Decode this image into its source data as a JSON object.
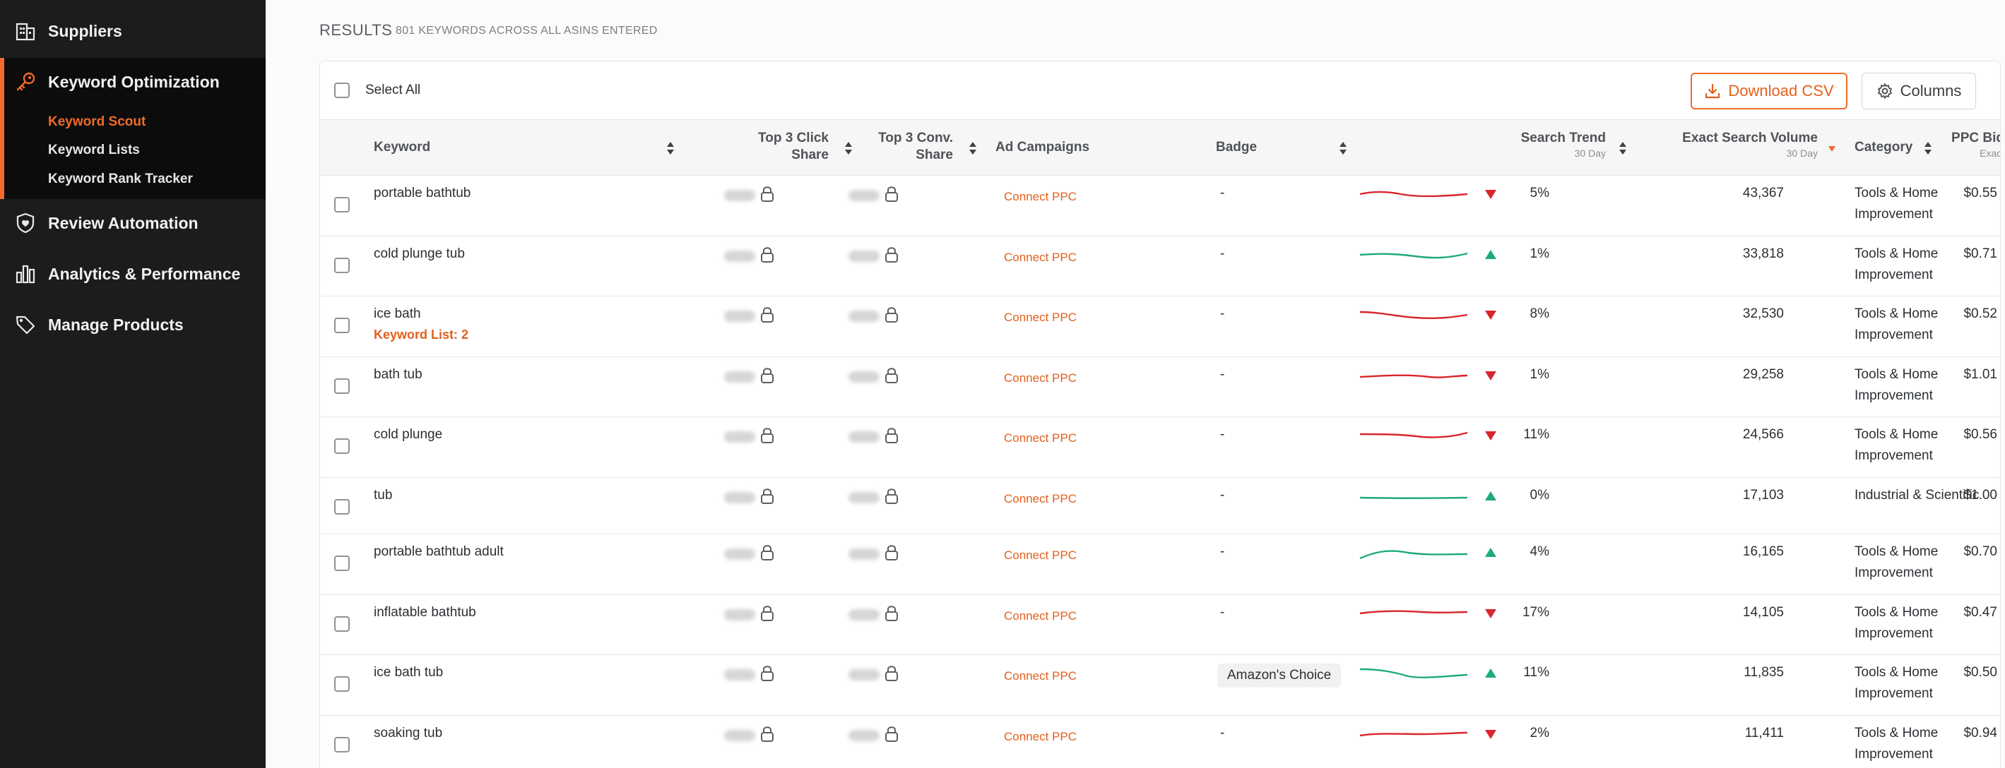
{
  "sidebar": {
    "items": [
      {
        "label": "Suppliers",
        "icon": "building-icon"
      },
      {
        "label": "Keyword Optimization",
        "icon": "key-icon",
        "active": true
      },
      {
        "label": "Review Automation",
        "icon": "review-shield-icon"
      },
      {
        "label": "Analytics & Performance",
        "icon": "bar-chart-icon"
      },
      {
        "label": "Manage Products",
        "icon": "tag-icon"
      }
    ],
    "subitems": [
      "Keyword Scout",
      "Keyword Lists",
      "Keyword Rank Tracker"
    ],
    "accent": "#f26b2a"
  },
  "results": {
    "heading": "RESULTS",
    "subheading": "801 KEYWORDS ACROSS ALL ASINS ENTERED"
  },
  "toolbar": {
    "select_all": "Select All",
    "download_csv": "Download CSV",
    "columns": "Columns"
  },
  "columns": {
    "keyword": "Keyword",
    "click_share_1": "Top 3 Click",
    "click_share_2": "Share",
    "conv_share_1": "Top 3 Conv.",
    "conv_share_2": "Share",
    "ad_campaigns": "Ad Campaigns",
    "badge": "Badge",
    "search_trend": "Search Trend",
    "search_trend_sub": "30 Day",
    "exact_volume": "Exact Search Volume",
    "exact_volume_sub": "30 Day",
    "category": "Category",
    "ppc_bid": "PPC Bid",
    "ppc_bid_sub": "Exact"
  },
  "rows": [
    {
      "keyword": "portable bathtub",
      "list": "",
      "ppc": "Connect PPC",
      "badge": "-",
      "trend": "down",
      "pct": "5%",
      "volume": "43,367",
      "category": "Tools & Home Improvement",
      "bid": "$0.55"
    },
    {
      "keyword": "cold plunge tub",
      "list": "",
      "ppc": "Connect PPC",
      "badge": "-",
      "trend": "up",
      "pct": "1%",
      "volume": "33,818",
      "category": "Tools & Home Improvement",
      "bid": "$0.71"
    },
    {
      "keyword": "ice bath",
      "list": "Keyword List: 2",
      "ppc": "Connect PPC",
      "badge": "-",
      "trend": "down",
      "pct": "8%",
      "volume": "32,530",
      "category": "Tools & Home Improvement",
      "bid": "$0.52"
    },
    {
      "keyword": "bath tub",
      "list": "",
      "ppc": "Connect PPC",
      "badge": "-",
      "trend": "down",
      "pct": "1%",
      "volume": "29,258",
      "category": "Tools & Home Improvement",
      "bid": "$1.01"
    },
    {
      "keyword": "cold plunge",
      "list": "",
      "ppc": "Connect PPC",
      "badge": "-",
      "trend": "down",
      "pct": "11%",
      "volume": "24,566",
      "category": "Tools & Home Improvement",
      "bid": "$0.56"
    },
    {
      "keyword": "tub",
      "list": "",
      "ppc": "Connect PPC",
      "badge": "-",
      "trend": "up",
      "pct": "0%",
      "volume": "17,103",
      "category": "Industrial & Scientific",
      "bid": "$1.00"
    },
    {
      "keyword": "portable bathtub adult",
      "list": "",
      "ppc": "Connect PPC",
      "badge": "-",
      "trend": "up",
      "pct": "4%",
      "volume": "16,165",
      "category": "Tools & Home Improvement",
      "bid": "$0.70"
    },
    {
      "keyword": "inflatable bathtub",
      "list": "",
      "ppc": "Connect PPC",
      "badge": "-",
      "trend": "down",
      "pct": "17%",
      "volume": "14,105",
      "category": "Tools & Home Improvement",
      "bid": "$0.47"
    },
    {
      "keyword": "ice bath tub",
      "list": "",
      "ppc": "Connect PPC",
      "badge": "Amazon's Choice",
      "trend": "up",
      "pct": "11%",
      "volume": "11,835",
      "category": "Tools & Home Improvement",
      "bid": "$0.50"
    },
    {
      "keyword": "soaking tub",
      "list": "",
      "ppc": "Connect PPC",
      "badge": "-",
      "trend": "down",
      "pct": "2%",
      "volume": "11,411",
      "category": "Tools & Home Improvement",
      "bid": "$0.94"
    }
  ],
  "colors": {
    "down": "#d9262c",
    "up": "#1fa97a",
    "orange": "#e2601f"
  }
}
